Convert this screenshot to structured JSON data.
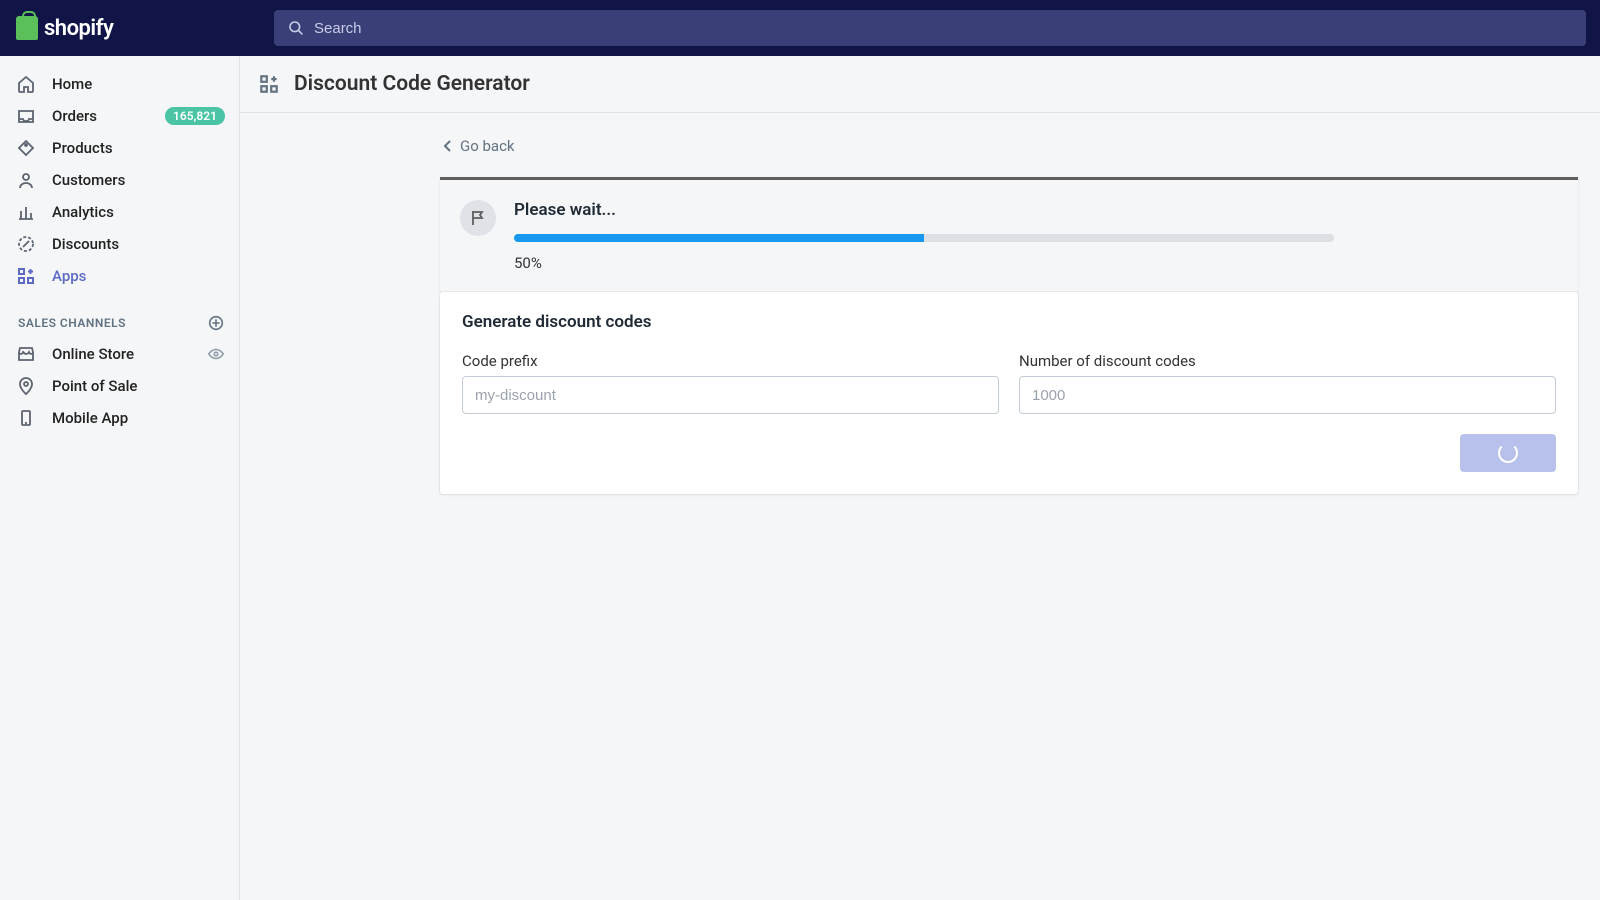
{
  "brand": "shopify",
  "search": {
    "placeholder": "Search"
  },
  "sidebar": {
    "items": [
      {
        "label": "Home"
      },
      {
        "label": "Orders",
        "badge": "165,821"
      },
      {
        "label": "Products"
      },
      {
        "label": "Customers"
      },
      {
        "label": "Analytics"
      },
      {
        "label": "Discounts"
      },
      {
        "label": "Apps"
      }
    ],
    "section_title": "SALES CHANNELS",
    "channels": [
      {
        "label": "Online Store"
      },
      {
        "label": "Point of Sale"
      },
      {
        "label": "Mobile App"
      }
    ]
  },
  "page": {
    "title": "Discount Code Generator",
    "go_back": "Go back"
  },
  "progress": {
    "title": "Please wait...",
    "percent": 50,
    "percent_label": "50%"
  },
  "form": {
    "title": "Generate discount codes",
    "prefix_label": "Code prefix",
    "prefix_placeholder": "my-discount",
    "count_label": "Number of discount codes",
    "count_placeholder": "1000"
  }
}
